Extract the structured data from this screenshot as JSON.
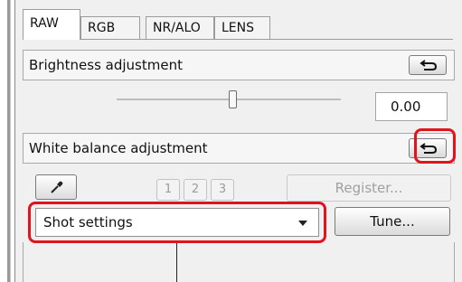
{
  "tabs": [
    {
      "label": "RAW",
      "active": true
    },
    {
      "label": "RGB",
      "active": false
    },
    {
      "label": "NR/ALO",
      "active": false
    },
    {
      "label": "LENS",
      "active": false
    }
  ],
  "brightness": {
    "label": "Brightness adjustment",
    "value": "0.00"
  },
  "white_balance": {
    "label": "White balance adjustment",
    "slots": [
      "1",
      "2",
      "3"
    ],
    "register_label": "Register...",
    "dropdown_value": "Shot settings",
    "tune_label": "Tune..."
  },
  "icons": {
    "reset": "reset-arrow-icon",
    "picker": "eyedropper-icon",
    "dropdown": "chevron-down-icon"
  },
  "colors": {
    "highlight": "#e0141e"
  }
}
